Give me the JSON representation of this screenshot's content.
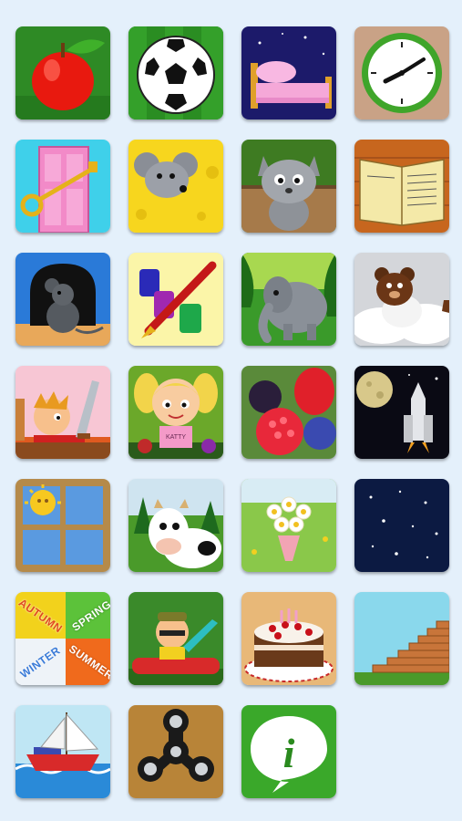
{
  "tiles": [
    {
      "id": "apple",
      "icon": "apple-icon"
    },
    {
      "id": "football",
      "icon": "football-icon"
    },
    {
      "id": "bed",
      "icon": "bed-icon"
    },
    {
      "id": "clock",
      "icon": "clock-icon"
    },
    {
      "id": "door-key",
      "icon": "door-key-icon"
    },
    {
      "id": "mouse-cheese",
      "icon": "mouse-cheese-icon"
    },
    {
      "id": "cat",
      "icon": "cat-icon"
    },
    {
      "id": "book",
      "icon": "book-icon"
    },
    {
      "id": "mouse-hole",
      "icon": "mouse-hole-icon"
    },
    {
      "id": "ink-pen",
      "icon": "ink-pen-icon"
    },
    {
      "id": "elephant",
      "icon": "elephant-icon"
    },
    {
      "id": "bear-clouds",
      "icon": "bear-clouds-icon"
    },
    {
      "id": "boy-sword",
      "icon": "boy-sword-icon"
    },
    {
      "id": "girl-katty",
      "icon": "girl-katty-icon",
      "card_text": "KATTY"
    },
    {
      "id": "berries",
      "icon": "berries-icon"
    },
    {
      "id": "moon-shuttle",
      "icon": "moon-shuttle-icon"
    },
    {
      "id": "window-sun",
      "icon": "window-sun-icon"
    },
    {
      "id": "cow",
      "icon": "cow-icon"
    },
    {
      "id": "flower-bouquet",
      "icon": "flower-bouquet-icon"
    },
    {
      "id": "night-stars",
      "icon": "night-stars-icon"
    },
    {
      "id": "seasons",
      "icon": "seasons-icon",
      "labels": {
        "autumn": "AUTUMN",
        "spring": "SPRING",
        "winter": "WINTER",
        "summer": "SUMMER"
      }
    },
    {
      "id": "man-car",
      "icon": "man-car-icon"
    },
    {
      "id": "cake",
      "icon": "cake-icon"
    },
    {
      "id": "brick-stairs",
      "icon": "brick-stairs-icon"
    },
    {
      "id": "boat",
      "icon": "boat-icon"
    },
    {
      "id": "fidget-spinner",
      "icon": "fidget-spinner-icon"
    },
    {
      "id": "info",
      "icon": "info-icon",
      "label": "i"
    }
  ]
}
